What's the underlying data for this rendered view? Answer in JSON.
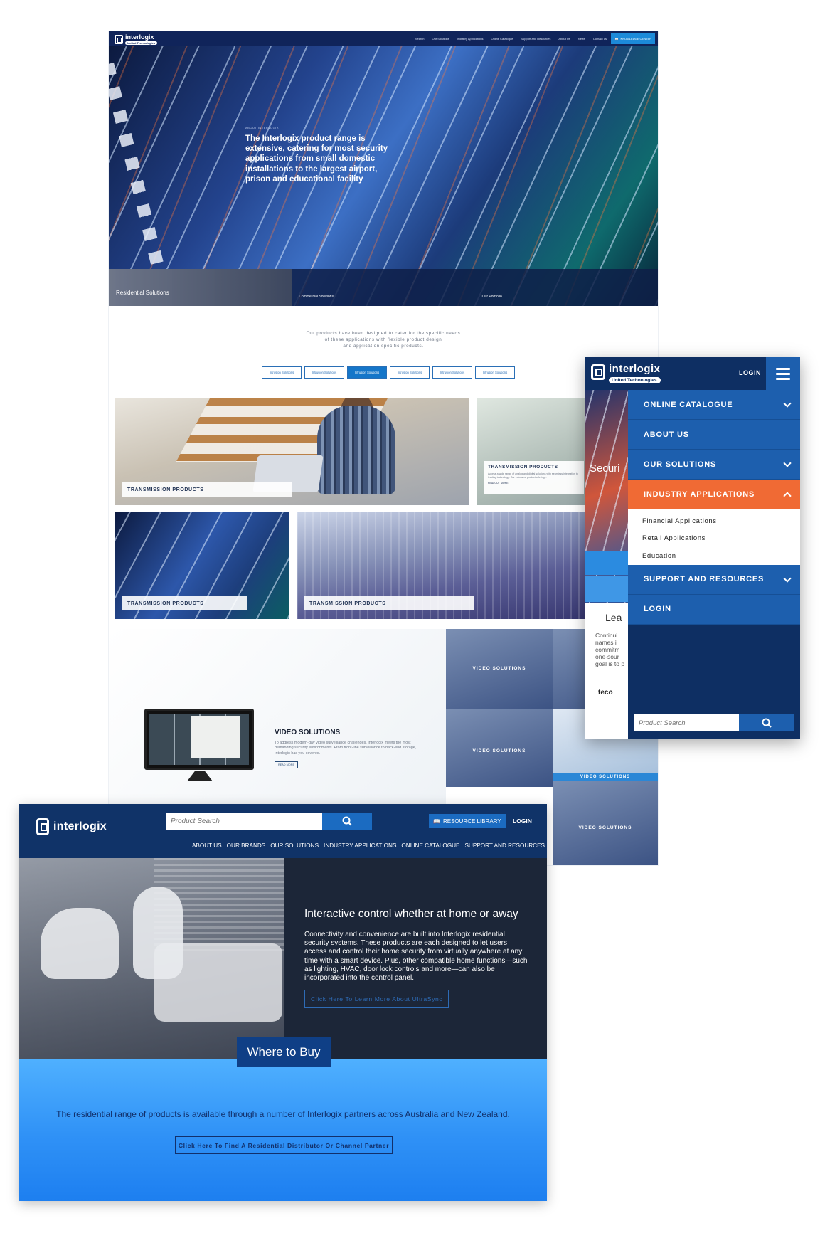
{
  "desktop": {
    "header": {
      "logo": "interlogix",
      "logo_tag": "United Technologies",
      "nav": [
        "Search",
        "Our Solutions",
        "Industry Applications",
        "Online Catalogue",
        "Support and Resources",
        "About Us",
        "News",
        "Contact us"
      ],
      "knowledge_center": "KNOWLEDGE CENTER"
    },
    "hero": {
      "kicker": "ABOUT INTERLOGIX",
      "headline": "The Interlogix product range is extensive, catering for most security applications from small domestic installations to the largest airport, prison and educational facility",
      "tiles": [
        "Residential Solutions",
        "Commercial Solutions",
        "Our Portfolio"
      ]
    },
    "intro": "Our products have been designed to cater for the specific needs\nof these applications with flexible product design\nand application specific products.",
    "tabs": [
      "Intrusion Solutions",
      "Intrusion Solutions",
      "Intrusion Solutions",
      "Intrusion Solutions",
      "Intrusion Solutions",
      "Intrusion Solutions"
    ],
    "active_tab": 2,
    "products": {
      "label": "TRANSMISSION PRODUCTS",
      "card_title": "TRANSMISSION PRODUCTS",
      "card_desc": "Access a wide range of analog and digital solutions with seamless integration to leading technology. Our extensive product offering...",
      "card_link": "FIND OUT MORE"
    },
    "video": {
      "title": "VIDEO SOLUTIONS",
      "desc": "To address modern-day video surveillance challenges, Interlogix meets the most demanding security environments. From front-line surveillance to back-end storage, Interlogix has you covered.",
      "button": "READ MORE",
      "tile_label": "VIDEO SOLUTIONS"
    }
  },
  "mobile": {
    "logo": "interlogix",
    "logo_tag": "United Technologies",
    "login": "LOGIN",
    "menu": [
      {
        "label": "ONLINE CATALOGUE"
      },
      {
        "label": "ABOUT US"
      },
      {
        "label": "OUR SOLUTIONS"
      },
      {
        "label": "INDUSTRY APPLICATIONS"
      },
      {
        "label": "SUPPORT AND RESOURCES"
      },
      {
        "label": "LOGIN"
      }
    ],
    "submenu": [
      "Financial Applications",
      "Retail Applications",
      "Education"
    ],
    "search_placeholder": "Product Search",
    "bg_text": {
      "secur": "Securi",
      "lead": "Lea",
      "small": "Continui\nnames i\ncommitm\none-sour\ngoal is to p",
      "vi": "VI",
      "teco": "teco"
    }
  },
  "residential": {
    "logo": "interlogix",
    "search_placeholder": "Product Search",
    "resource_library": "RESOURCE LIBRARY",
    "login": "LOGIN",
    "nav": [
      "ABOUT US",
      "OUR BRANDS",
      "OUR SOLUTIONS",
      "INDUSTRY APPLICATIONS",
      "ONLINE CATALOGUE",
      "SUPPORT AND RESOURCES"
    ],
    "title": "Interactive control whether at home or away",
    "body": "Connectivity and convenience are built into Interlogix residential security systems. These products are each designed to let users access and control their home security from virtually anywhere at any time with a smart device. Plus, other compatible home functions—such as lighting, HVAC, door lock controls and more—can also be incorporated into the control panel.",
    "cta": "Click Here To Learn More About UltraSync",
    "where_to_buy": "Where to Buy",
    "where_text": "The residential range of products is available through a number of Interlogix partners across Australia and New Zealand.",
    "where_cta": "Click Here To Find A Residential Distributor Or Channel Partner"
  }
}
